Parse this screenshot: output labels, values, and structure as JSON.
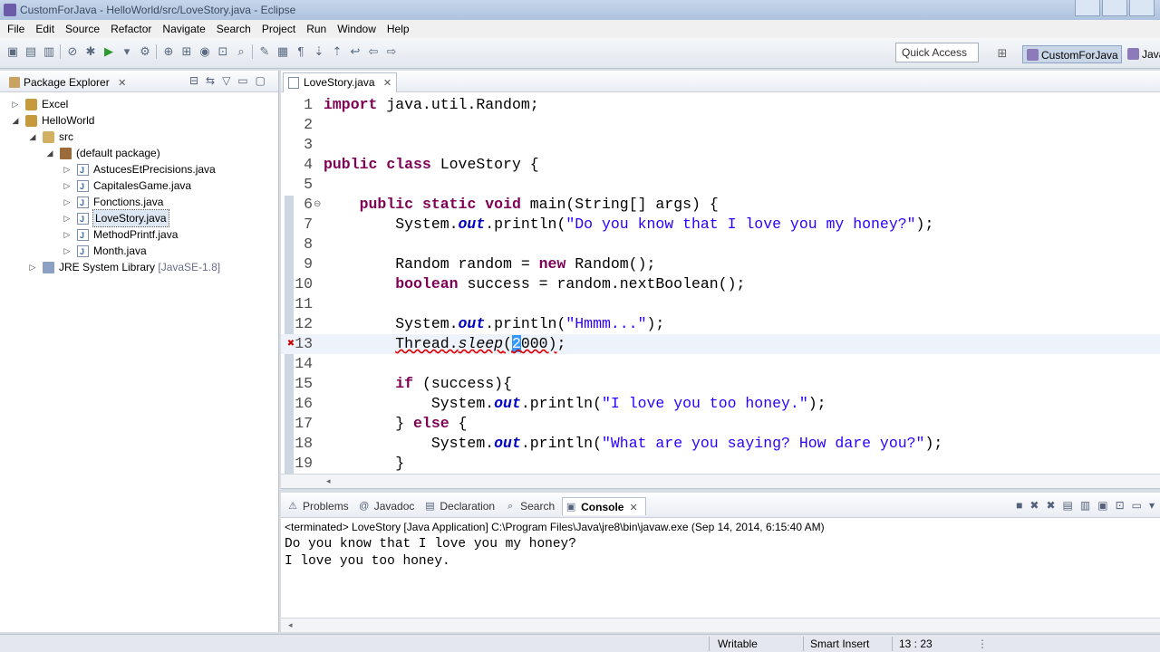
{
  "window": {
    "title": "CustomForJava - HelloWorld/src/LoveStory.java - Eclipse"
  },
  "menu": [
    "File",
    "Edit",
    "Source",
    "Refactor",
    "Navigate",
    "Search",
    "Project",
    "Run",
    "Window",
    "Help"
  ],
  "toolbar": {
    "quick_access": "Quick Access",
    "perspective_active": "CustomForJava",
    "perspective_other": "Java"
  },
  "package_explorer": {
    "title": "Package Explorer",
    "tree": [
      {
        "label": "Excel",
        "icon": "project-icon",
        "depth": 0,
        "twisty": "▷"
      },
      {
        "label": "HelloWorld",
        "icon": "project-icon",
        "depth": 0,
        "twisty": "◢"
      },
      {
        "label": "src",
        "icon": "source-folder-icon",
        "depth": 1,
        "twisty": "◢"
      },
      {
        "label": "(default package)",
        "icon": "package-icon",
        "depth": 2,
        "twisty": "◢"
      },
      {
        "label": "AstucesEtPrecisions.java",
        "icon": "java-file-icon",
        "depth": 3,
        "twisty": "▷"
      },
      {
        "label": "CapitalesGame.java",
        "icon": "java-file-icon",
        "depth": 3,
        "twisty": "▷"
      },
      {
        "label": "Fonctions.java",
        "icon": "java-file-icon",
        "depth": 3,
        "twisty": "▷"
      },
      {
        "label": "LoveStory.java",
        "icon": "java-file-icon",
        "depth": 3,
        "twisty": "▷",
        "selected": true
      },
      {
        "label": "MethodPrintf.java",
        "icon": "java-file-icon",
        "depth": 3,
        "twisty": "▷"
      },
      {
        "label": "Month.java",
        "icon": "java-file-icon",
        "depth": 3,
        "twisty": "▷"
      },
      {
        "label": "JRE System Library",
        "suffix": "[JavaSE-1.8]",
        "icon": "library-icon",
        "depth": 1,
        "twisty": "▷"
      }
    ]
  },
  "editor": {
    "tab_label": "LoveStory.java",
    "lines": [
      {
        "n": "1",
        "tokens": [
          [
            "kw",
            "import"
          ],
          [
            "",
            "java.util.Random;"
          ]
        ]
      },
      {
        "n": "2",
        "tokens": []
      },
      {
        "n": "3",
        "tokens": []
      },
      {
        "n": "4",
        "tokens": [
          [
            "kw",
            "public"
          ],
          [
            "",
            ""
          ],
          [
            "kw",
            "class"
          ],
          [
            "",
            "LoveStory {"
          ]
        ]
      },
      {
        "n": "5",
        "tokens": []
      },
      {
        "n": "6",
        "fold": "⊖",
        "tokens": [
          [
            "",
            "    "
          ],
          [
            "kw",
            "public"
          ],
          [
            "",
            ""
          ],
          [
            "kw",
            "static"
          ],
          [
            "",
            ""
          ],
          [
            "kw",
            "void"
          ],
          [
            "",
            "main(String[] args) {"
          ]
        ]
      },
      {
        "n": "7",
        "tokens": [
          [
            "",
            "        System."
          ],
          [
            "fld",
            "out"
          ],
          [
            "",
            ".println("
          ],
          [
            "str",
            "\"Do you know that I love you my honey?\""
          ],
          [
            "",
            ");"
          ]
        ]
      },
      {
        "n": "8",
        "tokens": []
      },
      {
        "n": "9",
        "tokens": [
          [
            "",
            "        Random random = "
          ],
          [
            "kw",
            "new"
          ],
          [
            "",
            "Random();"
          ]
        ]
      },
      {
        "n": "10",
        "tokens": [
          [
            "",
            "        "
          ],
          [
            "kw",
            "boolean"
          ],
          [
            "",
            "success = random.nextBoolean();"
          ]
        ]
      },
      {
        "n": "11",
        "tokens": []
      },
      {
        "n": "12",
        "tokens": [
          [
            "",
            "        System."
          ],
          [
            "fld",
            "out"
          ],
          [
            "",
            ".println("
          ],
          [
            "str",
            "\"Hmmm...\""
          ],
          [
            "",
            ");"
          ]
        ]
      },
      {
        "n": "13",
        "current": true,
        "error": true,
        "tokens": [
          [
            "",
            "        "
          ],
          [
            "err",
            "Thread."
          ],
          [
            "errit",
            "sleep"
          ],
          [
            "err",
            "("
          ],
          [
            "sel",
            "2"
          ],
          [
            "err",
            "000)"
          ],
          [
            "",
            ";"
          ]
        ]
      },
      {
        "n": "14",
        "tokens": []
      },
      {
        "n": "15",
        "tokens": [
          [
            "",
            "        "
          ],
          [
            "kw",
            "if"
          ],
          [
            "",
            "(success){"
          ]
        ]
      },
      {
        "n": "16",
        "tokens": [
          [
            "",
            "            System."
          ],
          [
            "fld",
            "out"
          ],
          [
            "",
            ".println("
          ],
          [
            "str",
            "\"I love you too honey.\""
          ],
          [
            "",
            ");"
          ]
        ]
      },
      {
        "n": "17",
        "tokens": [
          [
            "",
            "        } "
          ],
          [
            "kw",
            "else"
          ],
          [
            "",
            "{"
          ]
        ]
      },
      {
        "n": "18",
        "tokens": [
          [
            "",
            "            System."
          ],
          [
            "fld",
            "out"
          ],
          [
            "",
            ".println("
          ],
          [
            "str",
            "\"What are you saying? How dare you?\""
          ],
          [
            "",
            ");"
          ]
        ]
      },
      {
        "n": "19",
        "tokens": [
          [
            "",
            "        }"
          ]
        ]
      }
    ]
  },
  "bottom_panel": {
    "tabs": [
      {
        "label": "Problems",
        "icon": "problems-icon"
      },
      {
        "label": "Javadoc",
        "icon": "javadoc-icon"
      },
      {
        "label": "Declaration",
        "icon": "declaration-icon"
      },
      {
        "label": "Search",
        "icon": "search-icon"
      },
      {
        "label": "Console",
        "icon": "console-icon",
        "active": true
      }
    ],
    "console_header": "<terminated> LoveStory [Java Application] C:\\Program Files\\Java\\jre8\\bin\\javaw.exe (Sep 14, 2014, 6:15:40 AM)",
    "console_output": [
      "Do you know that I love you my honey?",
      "I love you too honey."
    ]
  },
  "status": {
    "writable": "Writable",
    "insert_mode": "Smart Insert",
    "position": "13 : 23"
  }
}
